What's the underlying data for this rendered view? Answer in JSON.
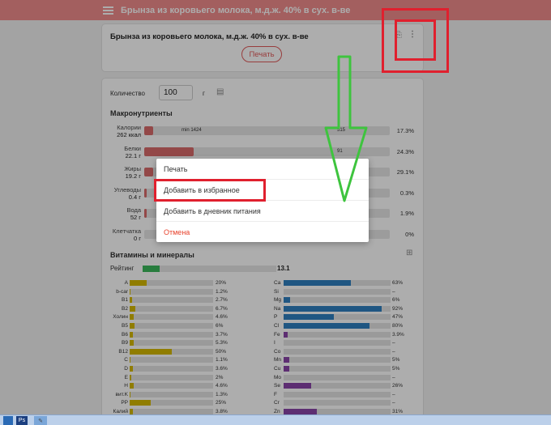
{
  "header": {
    "title": "Брынза из коровьего молока, м.д.ж. 40% в сух. в-ве"
  },
  "product": {
    "title": "Брынза из коровьего молока, м.д.ж. 40% в сух. в-ве",
    "print_label": "Печать"
  },
  "quantity": {
    "label": "Количество",
    "value": "100",
    "unit": "г"
  },
  "macros": {
    "title": "Макронутриенты",
    "rows": [
      {
        "name": "Калории",
        "amount": "262 ккал",
        "fill": 0.035,
        "note": "min 1424",
        "note2": "515",
        "percent": "17.3%"
      },
      {
        "name": "Белки",
        "amount": "22.1 г",
        "fill": 0.2,
        "note": "",
        "note2": "91",
        "percent": "24.3%"
      },
      {
        "name": "Жиры",
        "amount": "19.2 г",
        "fill": 0.035,
        "note": "",
        "note2": "",
        "percent": "29.1%"
      },
      {
        "name": "Углеводы",
        "amount": "0.4 г",
        "fill": 0.01,
        "note": "",
        "note2": "",
        "percent": "0.3%"
      },
      {
        "name": "Вода",
        "amount": "52 г",
        "fill": 0.01,
        "note": "",
        "note2": "",
        "percent": "1.9%"
      },
      {
        "name": "Клетчатка",
        "amount": "0 г",
        "fill": 0,
        "note": "",
        "note2": "",
        "percent": "0%"
      }
    ]
  },
  "vitamins": {
    "title": "Витамины и минералы",
    "rating_label": "Рейтинг",
    "rating_value": "13.1",
    "rating_fill": 0.13,
    "left": [
      {
        "name": "A",
        "fill": 0.2,
        "percent": "20%"
      },
      {
        "name": "b-car",
        "fill": 0.012,
        "percent": "1.2%"
      },
      {
        "name": "B1",
        "fill": 0.027,
        "percent": "2.7%"
      },
      {
        "name": "B2",
        "fill": 0.067,
        "percent": "6.7%"
      },
      {
        "name": "Холин",
        "fill": 0.046,
        "percent": "4.6%"
      },
      {
        "name": "B5",
        "fill": 0.06,
        "percent": "6%"
      },
      {
        "name": "B6",
        "fill": 0.037,
        "percent": "3.7%"
      },
      {
        "name": "B9",
        "fill": 0.053,
        "percent": "5.3%"
      },
      {
        "name": "B12",
        "fill": 0.5,
        "percent": "50%"
      },
      {
        "name": "C",
        "fill": 0.011,
        "percent": "1.1%"
      },
      {
        "name": "D",
        "fill": 0.036,
        "percent": "3.6%"
      },
      {
        "name": "E",
        "fill": 0.02,
        "percent": "2%"
      },
      {
        "name": "H",
        "fill": 0.046,
        "percent": "4.6%"
      },
      {
        "name": "вит.K",
        "fill": 0.013,
        "percent": "1.3%"
      },
      {
        "name": "PP",
        "fill": 0.25,
        "percent": "25%"
      },
      {
        "name": "Калий",
        "fill": 0.038,
        "percent": "3.8%"
      }
    ],
    "right": [
      {
        "name": "Ca",
        "fill": 0.63,
        "percent": "63%"
      },
      {
        "name": "Si",
        "fill": 0,
        "percent": "–"
      },
      {
        "name": "Mg",
        "fill": 0.06,
        "percent": "6%"
      },
      {
        "name": "Na",
        "fill": 0.92,
        "percent": "92%"
      },
      {
        "name": "P",
        "fill": 0.47,
        "percent": "47%"
      },
      {
        "name": "Cl",
        "fill": 0.8,
        "percent": "80%"
      },
      {
        "name": "Fe",
        "fill": 0.039,
        "percent": "3.9%"
      },
      {
        "name": "I",
        "fill": 0,
        "percent": "–"
      },
      {
        "name": "Co",
        "fill": 0,
        "percent": "–"
      },
      {
        "name": "Mn",
        "fill": 0.05,
        "percent": "5%"
      },
      {
        "name": "Cu",
        "fill": 0.05,
        "percent": "5%"
      },
      {
        "name": "Mo",
        "fill": 0,
        "percent": "–"
      },
      {
        "name": "Se",
        "fill": 0.26,
        "percent": "26%"
      },
      {
        "name": "F",
        "fill": 0,
        "percent": "–"
      },
      {
        "name": "Cr",
        "fill": 0,
        "percent": "–"
      },
      {
        "name": "Zn",
        "fill": 0.31,
        "percent": "31%"
      }
    ]
  },
  "menu": {
    "items": [
      "Печать",
      "Добавить в избранное",
      "Добавить в дневник питания"
    ],
    "cancel": "Отмена"
  },
  "colors": {
    "header": "#f08c8c",
    "macro_bar": "#d96a6a",
    "vitamin_bar": "#d4b800",
    "mineral_bar": "#2f7fc0",
    "mineral_bar_alt": "#8a44a8",
    "rating_bar": "#3cb95c",
    "annotation_red": "#e0202e",
    "annotation_green": "#3ec43e"
  },
  "taskbar": {
    "apps": [
      "Ps"
    ]
  }
}
